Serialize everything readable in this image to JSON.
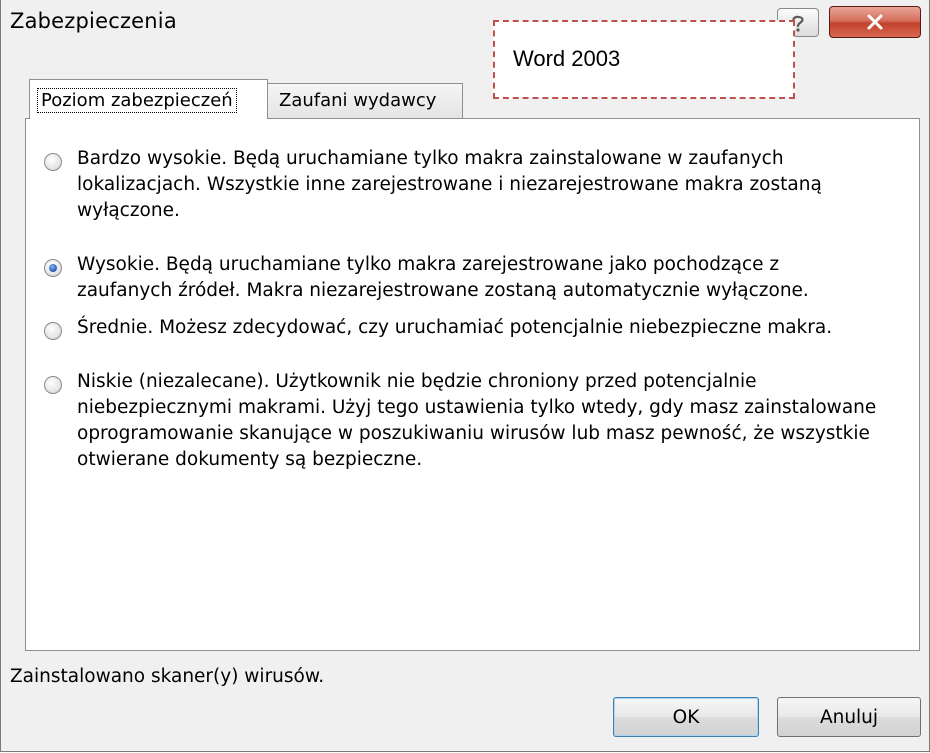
{
  "window": {
    "title": "Zabezpieczenia"
  },
  "titlebar": {
    "help_icon": "help-icon",
    "help_glyph": "?",
    "close_icon": "close-icon",
    "close_glyph": "x"
  },
  "annotation": {
    "text": "Word 2003",
    "border_color": "#c0504d"
  },
  "tabs": [
    {
      "label": "Poziom zabezpieczeń",
      "active": true
    },
    {
      "label": "Zaufani wydawcy",
      "active": false
    }
  ],
  "options": [
    {
      "text": "Bardzo wysokie. Będą uruchamiane tylko makra zainstalowane w zaufanych\nlokalizacjach. Wszystkie inne zarejestrowane i niezarejestrowane makra zostaną\nwyłączone.",
      "checked": false
    },
    {
      "text": "Wysokie. Będą uruchamiane tylko makra zarejestrowane jako pochodzące z\nzaufanych źródeł. Makra niezarejestrowane zostaną automatycznie wyłączone.",
      "checked": true
    },
    {
      "text": "Średnie. Możesz zdecydować, czy uruchamiać potencjalnie niebezpieczne makra.",
      "checked": false
    },
    {
      "text": "Niskie (niezalecane). Użytkownik nie będzie chroniony przed potencjalnie\nniebezpiecznymi makrami. Użyj tego ustawienia tylko wtedy, gdy masz zainstalowane\noprogramowanie skanujące w poszukiwaniu wirusów lub masz pewność, że wszystkie\notwierane dokumenty są bezpieczne.",
      "checked": false
    }
  ],
  "status": {
    "text": "Zainstalowano skaner(y) wirusów."
  },
  "buttons": {
    "ok": "OK",
    "cancel": "Anuluj"
  },
  "colors": {
    "close_button": "#c7432e",
    "radio_selected": "#2a62c6",
    "default_button_border": "#3c7fb1"
  }
}
